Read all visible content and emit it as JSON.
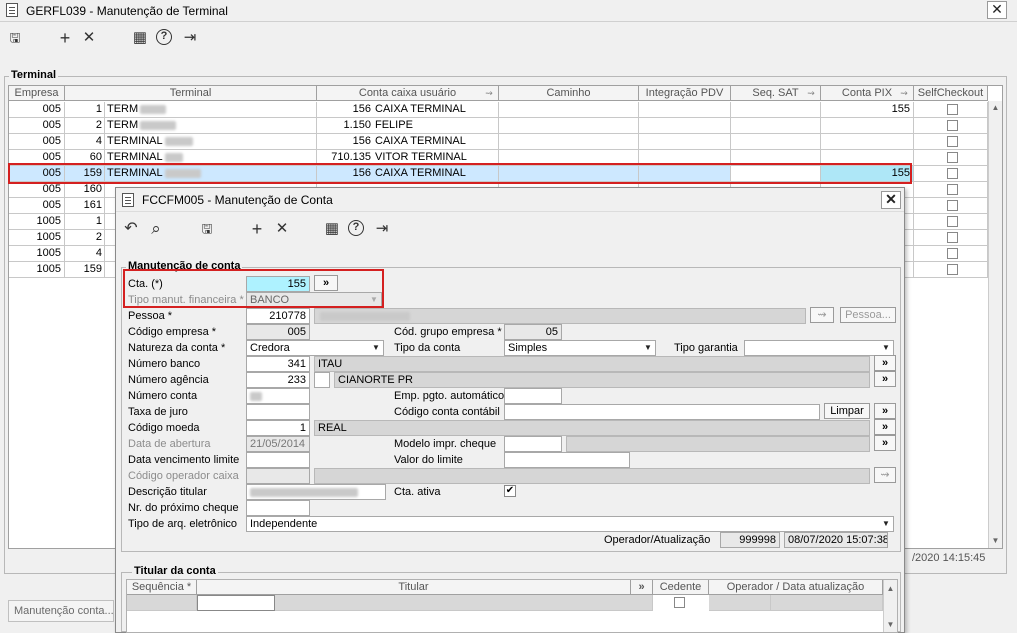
{
  "main": {
    "title": "GERFL039 - Manutenção de Terminal",
    "close": "✕",
    "toolbar": {
      "save": "🖫",
      "add": "+",
      "delete": "✕",
      "calendar": "▦",
      "help": "?",
      "exit": "⇥"
    },
    "group_label": "Terminal",
    "columns": [
      "Empresa",
      "Terminal",
      "Conta caixa usuário",
      "Caminho",
      "Integração PDV",
      "Seq. SAT",
      "Conta PIX",
      "SelfCheckout"
    ],
    "rows": [
      {
        "empresa": "005",
        "num": "1",
        "terminal": "TERM",
        "conta": "156",
        "conta_nome": "CAIXA TERMINAL",
        "pix": "155"
      },
      {
        "empresa": "005",
        "num": "2",
        "terminal": "TERM",
        "conta": "1.150",
        "conta_nome": "FELIPE",
        "pix": ""
      },
      {
        "empresa": "005",
        "num": "4",
        "terminal": "TERMINAL",
        "conta": "156",
        "conta_nome": "CAIXA TERMINAL",
        "pix": ""
      },
      {
        "empresa": "005",
        "num": "60",
        "terminal": "TERMINAL",
        "conta": "710.135",
        "conta_nome": "VITOR TERMINAL",
        "pix": ""
      },
      {
        "empresa": "005",
        "num": "159",
        "terminal": "TERMINAL",
        "conta": "156",
        "conta_nome": "CAIXA TERMINAL",
        "pix": "155"
      },
      {
        "empresa": "005",
        "num": "160",
        "terminal": "",
        "conta": "",
        "conta_nome": "",
        "pix": ""
      },
      {
        "empresa": "005",
        "num": "161",
        "terminal": "",
        "conta": "",
        "conta_nome": "",
        "pix": ""
      },
      {
        "empresa": "1005",
        "num": "1",
        "terminal": "",
        "conta": "",
        "conta_nome": "",
        "pix": ""
      },
      {
        "empresa": "1005",
        "num": "2",
        "terminal": "",
        "conta": "",
        "conta_nome": "",
        "pix": ""
      },
      {
        "empresa": "1005",
        "num": "4",
        "terminal": "",
        "conta": "",
        "conta_nome": "",
        "pix": ""
      },
      {
        "empresa": "1005",
        "num": "159",
        "terminal": "",
        "conta": "",
        "conta_nome": "",
        "pix": ""
      }
    ],
    "status_time": "/2020 14:15:45",
    "taskbar_item": "Manutenção conta..."
  },
  "dialog": {
    "title": "FCCFM005 - Manutenção de Conta",
    "close": "✕",
    "toolbar": {
      "undo": "↶",
      "search": "⌕",
      "save": "🖫",
      "add": "+",
      "delete": "✕",
      "calendar": "▦",
      "help": "?",
      "exit": "⇥"
    },
    "section_title": "Manutenção de conta",
    "fields": {
      "cta_label": "Cta. (*)",
      "cta_value": "155",
      "cta_btn": "»",
      "tipo_manut_label": "Tipo manut. financeira *",
      "tipo_manut_value": "BANCO",
      "pessoa_label": "Pessoa *",
      "pessoa_value": "210778",
      "pessoa_btn": "Pessoa...",
      "cod_empresa_label": "Código empresa *",
      "cod_empresa_value": "005",
      "cod_grupo_label": "Cód. grupo empresa *",
      "cod_grupo_value": "05",
      "natureza_label": "Natureza da conta *",
      "natureza_value": "Credora",
      "tipo_conta_label": "Tipo da conta",
      "tipo_conta_value": "Simples",
      "tipo_garantia_label": "Tipo garantia",
      "tipo_garantia_value": "",
      "num_banco_label": "Número banco",
      "num_banco_value": "341",
      "banco_nome": "ITAU",
      "num_agencia_label": "Número agência",
      "num_agencia_value": "233",
      "agencia_nome": "CIANORTE PR",
      "num_conta_label": "Número conta",
      "emp_pgto_label": "Emp. pgto. automático",
      "taxa_label": "Taxa de juro",
      "cod_contabil_label": "Código conta contábil",
      "limpar_btn": "Limpar",
      "cod_moeda_label": "Código moeda",
      "cod_moeda_value": "1",
      "moeda_nome": "REAL",
      "data_abertura_label": "Data de abertura",
      "data_abertura_value": "21/05/2014",
      "modelo_cheque_label": "Modelo impr. cheque",
      "data_venc_label": "Data vencimento limite",
      "valor_limite_label": "Valor do limite",
      "cod_operador_label": "Código operador caixa",
      "desc_titular_label": "Descrição titular",
      "cta_ativa_label": "Cta. ativa",
      "cta_ativa_check": "✔",
      "proximo_cheque_label": "Nr. do próximo cheque",
      "tipo_arq_label": "Tipo de arq. eletrônico",
      "tipo_arq_value": "Independente",
      "operador_label": "Operador/Atualização",
      "operador_value": "999998",
      "atualizacao_value": "08/07/2020 15:07:38"
    },
    "titular": {
      "title": "Titular da conta",
      "columns": [
        "Sequência *",
        "Titular",
        "Cedente",
        "Operador / Data atualização"
      ]
    }
  }
}
